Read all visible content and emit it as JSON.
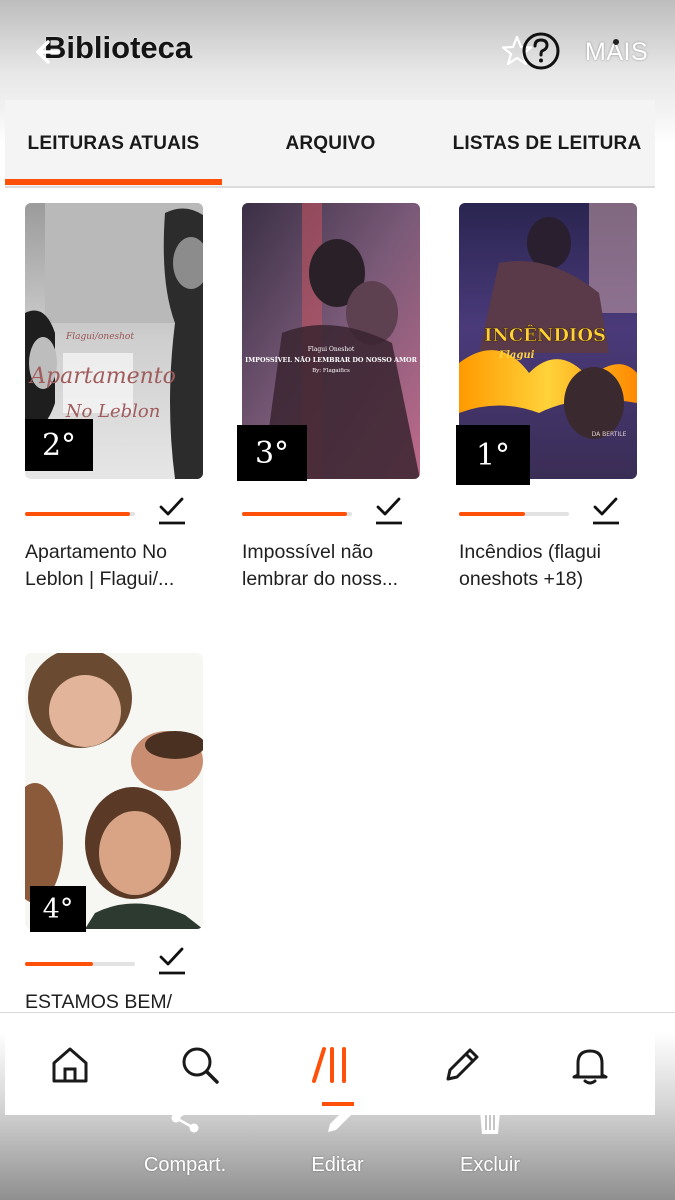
{
  "header": {
    "title": "Biblioteca",
    "more_label": "MAIS"
  },
  "tabs": [
    {
      "label": "LEITURAS ATUAIS",
      "active": true
    },
    {
      "label": "ARQUIVO",
      "active": false
    },
    {
      "label": "LISTAS DE LEITURA",
      "active": false
    }
  ],
  "books": [
    {
      "rank": "2°",
      "cover_author": "Flagui/oneshot",
      "cover_title_1": "Apartamento",
      "cover_title_2": "No Leblon",
      "title_line1": "Apartamento No",
      "title_line2": "Leblon | Flagui/...",
      "progress": 0.95
    },
    {
      "rank": "3°",
      "cover_author": "Flagui Oneshot",
      "cover_title_1": "IMPOSSÍVEL NÃO LEMBRAR DO NOSSO AMOR",
      "cover_byline": "By: Flagaifics",
      "title_line1": "Impossível não",
      "title_line2": "lembrar do noss...",
      "progress": 0.95
    },
    {
      "rank": "1°",
      "cover_title_1": "INCÊNDIOS",
      "cover_author": "Flagui",
      "cover_byline": "DA BERTILE",
      "title_line1": "Incêndios (flagui",
      "title_line2": "oneshots +18)",
      "progress": 0.6
    },
    {
      "rank": "4°",
      "title_line1": "ESTAMOS BEM/",
      "title_line2": "",
      "progress": 0.62
    }
  ],
  "actions": [
    {
      "label": "Compart.",
      "icon": "share-icon"
    },
    {
      "label": "Editar",
      "icon": "edit-icon"
    },
    {
      "label": "Excluir",
      "icon": "trash-icon"
    }
  ],
  "colors": {
    "accent": "#ff500a",
    "text": "#1f1f1f"
  }
}
